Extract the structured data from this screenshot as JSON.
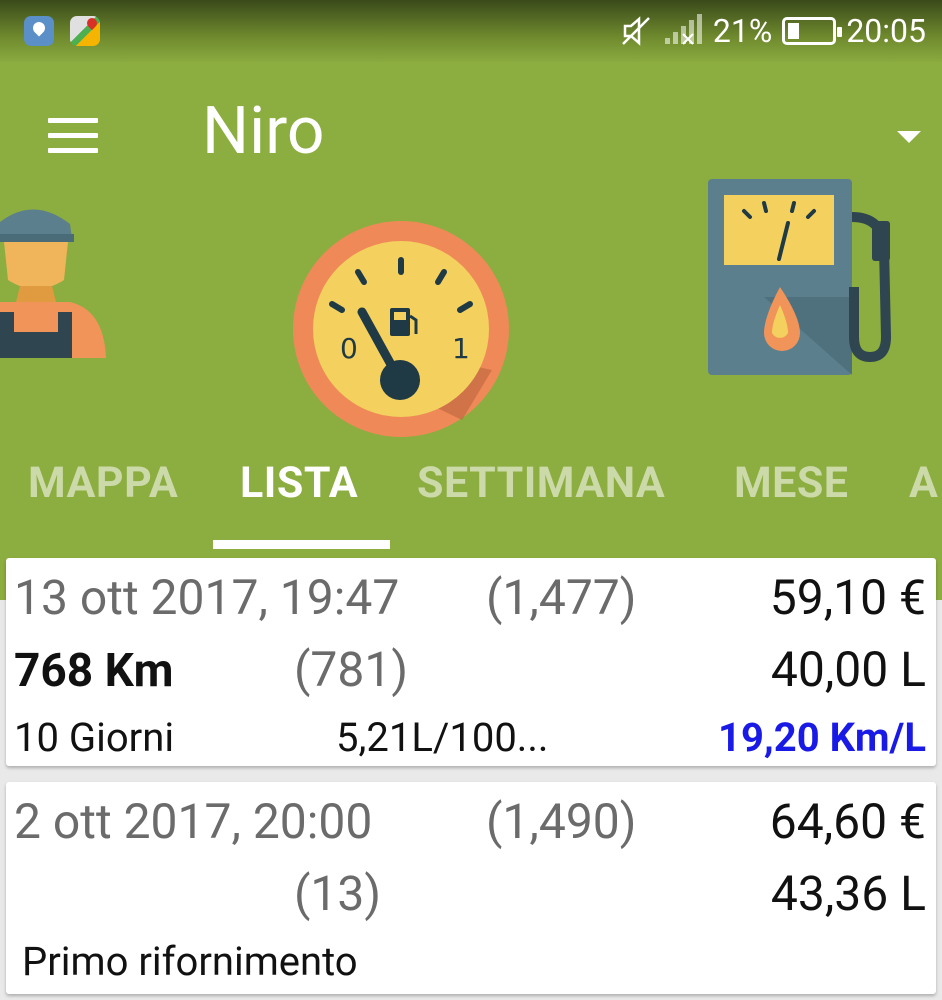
{
  "status_bar": {
    "battery": "21%",
    "time": "20:05"
  },
  "toolbar": {
    "title": "Niro"
  },
  "tabs": [
    {
      "label": "MAPPA"
    },
    {
      "label": "LISTA"
    },
    {
      "label": "SETTIMANA"
    },
    {
      "label": "MESE"
    },
    {
      "label": "A"
    }
  ],
  "active_tab": "LISTA",
  "colors": {
    "header": "#8cad3f",
    "accent_blue": "#1a1ae6",
    "text_gray": "#6b6b6b"
  },
  "refuels": [
    {
      "datetime": "13 ott 2017, 19:47",
      "price_per_liter": "(1,477)",
      "total_cost": "59,10 €",
      "distance": "768 Km",
      "distance_delta": "(781)",
      "liters": "40,00 L",
      "days": "10 Giorni",
      "consumption_per_100": "5,21L/100...",
      "efficiency": "19,20 Km/L"
    },
    {
      "datetime": "2 ott 2017, 20:00",
      "price_per_liter": "(1,490)",
      "total_cost": "64,60 €",
      "distance_delta": "(13)",
      "liters": "43,36 L",
      "note": "Primo rifornimento"
    }
  ]
}
